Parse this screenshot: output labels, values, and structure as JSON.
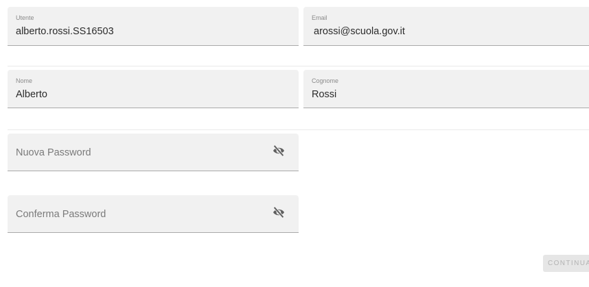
{
  "profile": {
    "utente": {
      "label": "Utente",
      "value": "alberto.rossi.SS16503"
    },
    "email": {
      "label": "Email",
      "value": "arossi@scuola.gov.it"
    },
    "nome": {
      "label": "Nome",
      "value": "Alberto"
    },
    "cognome": {
      "label": "Cognome",
      "value": "Rossi"
    }
  },
  "password": {
    "new_placeholder": "Nuova Password",
    "confirm_placeholder": "Conferma Password",
    "toggle_icon": "eye-off-icon"
  },
  "actions": {
    "continue_label": "CONTINUA"
  },
  "colors": {
    "field_bg": "#f1f1f1",
    "icon": "#5f5f5f",
    "button_bg": "#e6e6e6",
    "button_text": "#b3b3b3"
  }
}
